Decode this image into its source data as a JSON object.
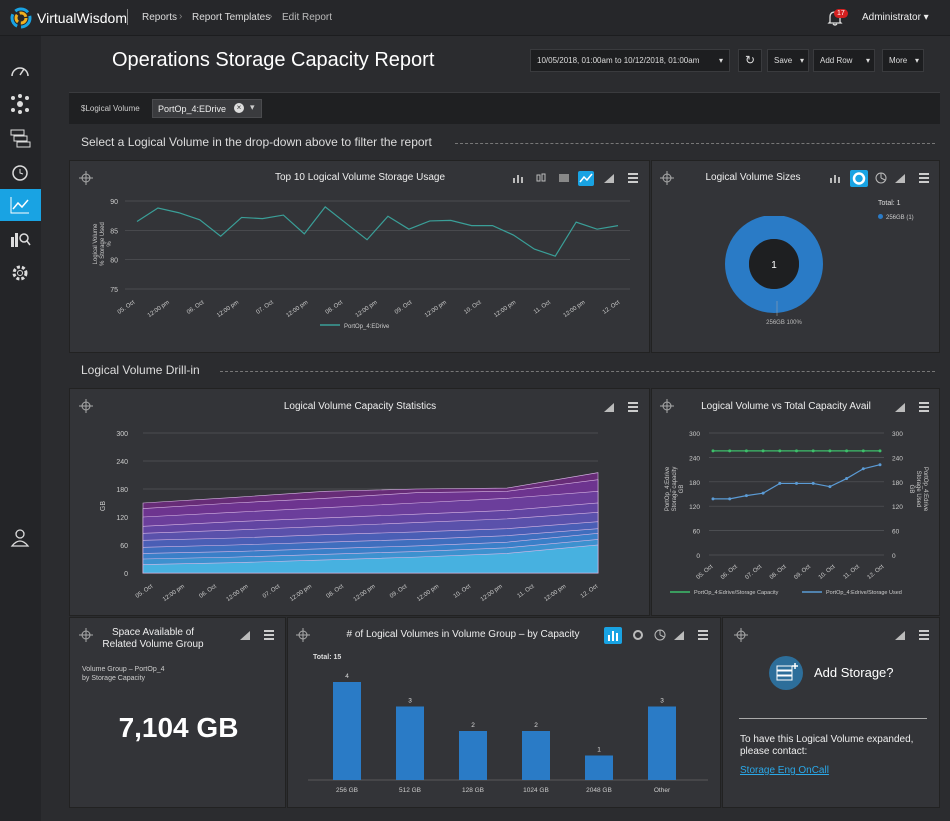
{
  "brand": "VirtualWisdom",
  "breadcrumb": [
    "Reports",
    "Report Templates",
    "Edit Report"
  ],
  "notifications": "17",
  "user": "Administrator",
  "page_title": "Operations Storage Capacity Report",
  "date_range": "10/05/2018, 01:00am  to  10/12/2018, 01:00am",
  "toolbar": {
    "save": "Save",
    "add_row": "Add Row",
    "more": "More"
  },
  "filter": {
    "label": "$Logical Volume",
    "value": "PortOp_4:EDrive"
  },
  "sections": {
    "filter_hint": "Select a Logical Volume in the drop-down above to filter the report",
    "drill": "Logical Volume Drill-in"
  },
  "panels": {
    "usage": {
      "title": "Top 10 Logical Volume Storage Usage",
      "ylabel": "Logical Volume\n% Storage Used\n%",
      "legend": "PortOp_4:EDrive"
    },
    "sizes": {
      "title": "Logical Volume Sizes",
      "total": "Total: 1",
      "legend": "256GB (1)",
      "center": "1",
      "slice_label": "256GB  100%"
    },
    "capstats": {
      "title": "Logical Volume Capacity Statistics",
      "ylabel": "GB"
    },
    "vs": {
      "title": "Logical Volume vs Total Capacity Avail",
      "ylabel_left": "PortOp_4:Edrive\nStorage capacity\nGB",
      "ylabel_right": "PortOp_4:Edrive\nStorage Used\nGB",
      "legend1": "PortOp_4:Edrive/Storage Capacity",
      "legend2": "PortOp_4:Edrive/Storage Used"
    },
    "space": {
      "title": "Space Available of\nRelated Volume Group",
      "sub": "Volume Group – PortOp_4\nby Storage Capacity",
      "value": "7,104 GB"
    },
    "groups": {
      "title": "# of Logical Volumes in Volume Group – by Capacity",
      "total": "Total: 15"
    },
    "add": {
      "title": "Add Storage?",
      "text": "To have this Logical Volume expanded,\nplease contact:",
      "link": "Storage Eng OnCall"
    }
  },
  "colors": {
    "accent": "#19a3e3",
    "line": "#3a9f98",
    "green": "#3dbf6a",
    "blue": "#5b9bd5",
    "bar": "#2a7bc6"
  },
  "chart_data": [
    {
      "type": "line",
      "title": "Top 10 Logical Volume Storage Usage",
      "ylabel": "Logical Volume % Storage Used %",
      "ylim": [
        75,
        90
      ],
      "yticks": [
        75,
        80,
        85,
        90
      ],
      "xticks": [
        "05. Oct",
        "12:00 pm",
        "06. Oct",
        "12:00 pm",
        "07. Oct",
        "12:00 pm",
        "08. Oct",
        "12:00 pm",
        "09. Oct",
        "12:00 pm",
        "10. Oct",
        "12:00 pm",
        "11. Oct",
        "12:00 pm",
        "12. Oct"
      ],
      "series": [
        {
          "name": "PortOp_4:EDrive",
          "values": [
            86.5,
            88.8,
            88,
            86.8,
            84,
            87.2,
            87,
            87.6,
            84.4,
            89,
            86.2,
            83.4,
            87.4,
            85.2,
            86.6,
            86.7,
            85.8,
            85.8,
            84.2,
            81.8,
            80.6,
            86.4,
            85.2,
            85.8
          ]
        }
      ]
    },
    {
      "type": "pie",
      "title": "Logical Volume Sizes",
      "series": [
        {
          "name": "256GB",
          "values": [
            1
          ]
        }
      ],
      "categories": [
        "256GB"
      ]
    },
    {
      "type": "area",
      "title": "Logical Volume Capacity Statistics",
      "ylabel": "GB",
      "ylim": [
        0,
        300
      ],
      "yticks": [
        0,
        60,
        120,
        180,
        240,
        300
      ],
      "xticks": [
        "05. Oct",
        "12:00 pm",
        "06. Oct",
        "12:00 pm",
        "07. Oct",
        "12:00 pm",
        "08. Oct",
        "12:00 pm",
        "09. Oct",
        "12:00 pm",
        "10. Oct",
        "12:00 pm",
        "11. Oct",
        "12:00 pm",
        "12. Oct"
      ],
      "series": [
        {
          "values": [
            150,
            162,
            175,
            180,
            182,
            215
          ]
        },
        {
          "values": [
            138,
            150,
            160,
            172,
            175,
            200
          ]
        },
        {
          "values": [
            120,
            130,
            140,
            150,
            160,
            175
          ]
        },
        {
          "values": [
            100,
            110,
            118,
            126,
            134,
            150
          ]
        },
        {
          "values": [
            85,
            92,
            100,
            108,
            116,
            130
          ]
        },
        {
          "values": [
            70,
            75,
            82,
            88,
            95,
            110
          ]
        },
        {
          "values": [
            55,
            60,
            66,
            72,
            80,
            95
          ]
        },
        {
          "values": [
            42,
            46,
            52,
            58,
            66,
            85
          ]
        },
        {
          "values": [
            30,
            34,
            40,
            46,
            54,
            72
          ]
        },
        {
          "values": [
            18,
            22,
            28,
            34,
            42,
            60
          ]
        }
      ]
    },
    {
      "type": "line",
      "title": "Logical Volume vs Total Capacity Avail",
      "ylim": [
        0,
        300
      ],
      "yticks": [
        0,
        60,
        120,
        180,
        240,
        300
      ],
      "xticks": [
        "05. Oct",
        "06. Oct",
        "07. Oct",
        "08. Oct",
        "09. Oct",
        "10. Oct",
        "11. Oct",
        "12. Oct"
      ],
      "series": [
        {
          "name": "PortOp_4:Edrive/Storage Capacity",
          "values": [
            256,
            256,
            256,
            256,
            256,
            256,
            256,
            256,
            256,
            256,
            256
          ]
        },
        {
          "name": "PortOp_4:Edrive/Storage Used",
          "values": [
            138,
            138,
            146,
            152,
            176,
            176,
            176,
            168,
            188,
            212,
            222
          ]
        }
      ]
    },
    {
      "type": "bar",
      "title": "# of Logical Volumes in Volume Group – by Capacity",
      "categories": [
        "256 GB",
        "512 GB",
        "128 GB",
        "1024 GB",
        "2048 GB",
        "Other"
      ],
      "values": [
        4,
        3,
        2,
        2,
        1,
        3
      ],
      "ylim": [
        0,
        4
      ]
    }
  ]
}
